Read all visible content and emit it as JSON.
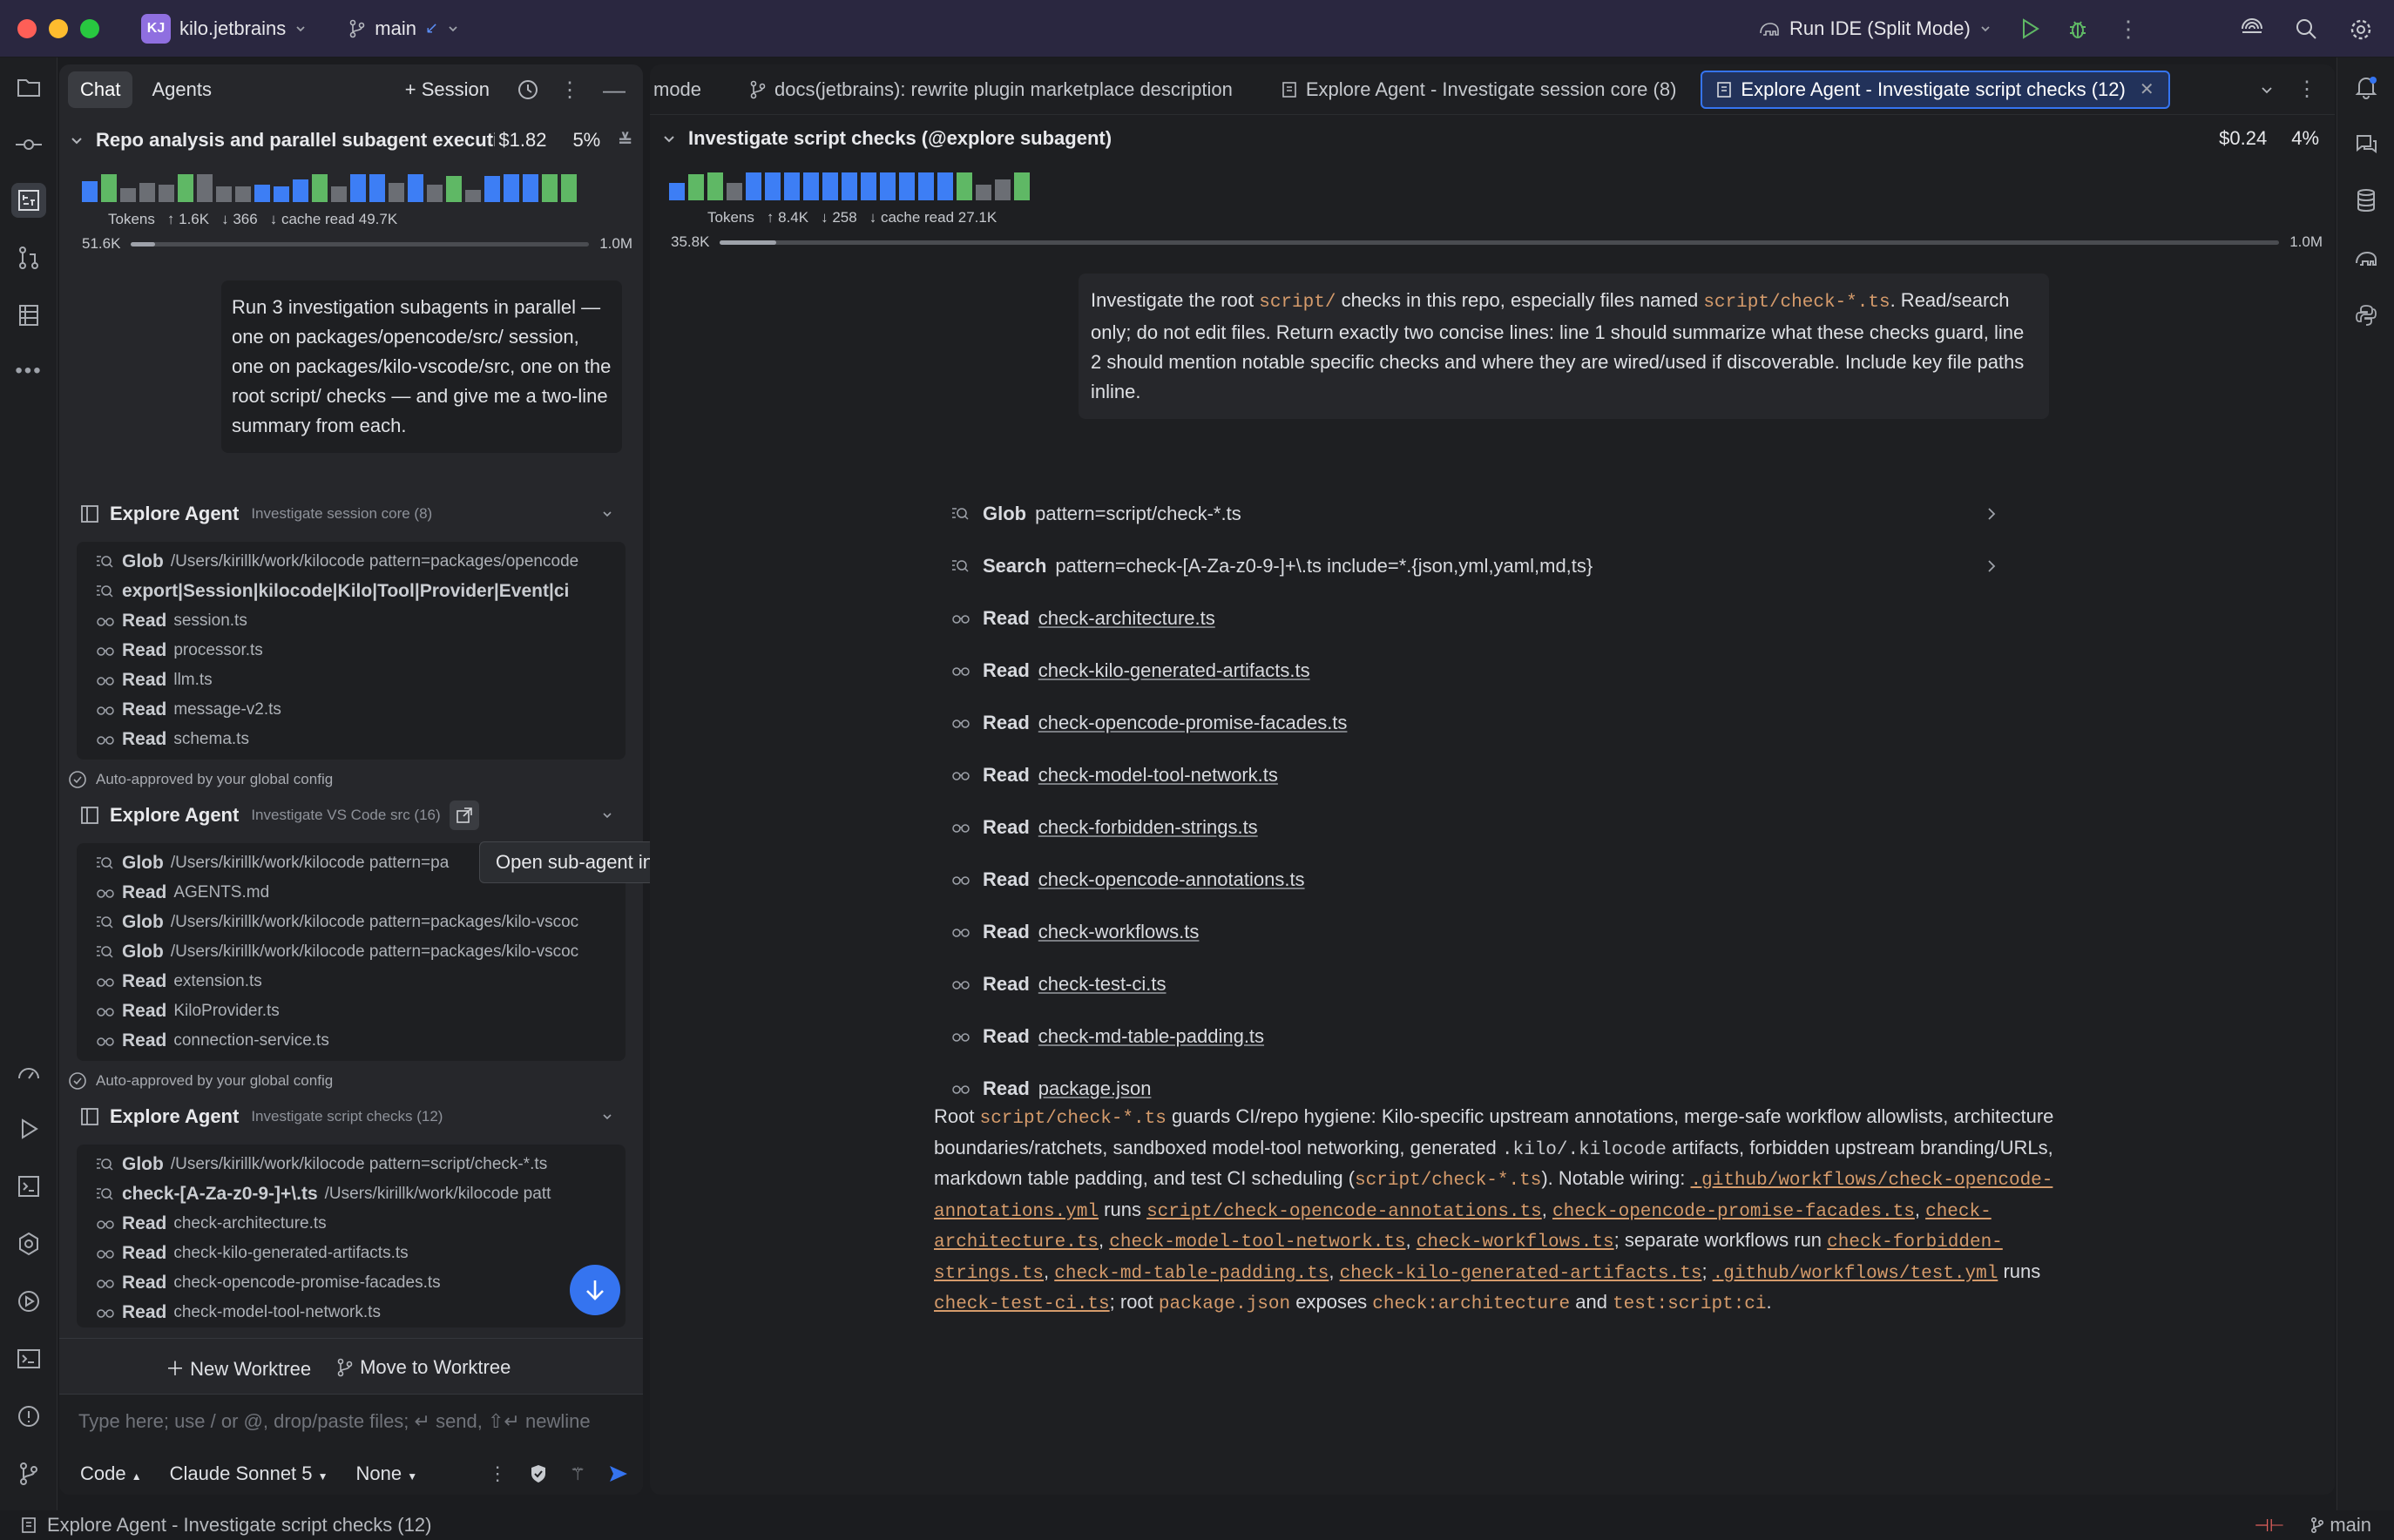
{
  "titlebar": {
    "project_badge": "KJ",
    "project_name": "kilo.jetbrains",
    "branch": "main",
    "run_config": "Run IDE (Split Mode)"
  },
  "chat": {
    "tabs": [
      "Chat",
      "Agents"
    ],
    "session_button": "+ Session",
    "session": {
      "title": "Repo analysis and parallel subagent executi...",
      "cost": "$1.82",
      "context_pct": "5%",
      "tokens_label": "Tokens",
      "tokens_up": "1.6K",
      "tokens_down": "366",
      "cache": "cache read 49.7K",
      "ctx_used": "51.6K",
      "ctx_max": "1.0M",
      "ctx_fraction": 0.052
    },
    "user_message": "Run 3 investigation subagents in parallel — one on packages/opencode/src/ session, one on packages/kilo-vscode/src, one on the root script/ checks — and give me a two-line summary from each.",
    "agents": [
      {
        "name": "Explore Agent",
        "desc": "Investigate session core (8)",
        "calls": [
          {
            "icon": "search-icon",
            "tool": "Glob",
            "arg": "/Users/kirillk/work/kilocode pattern=packages/opencode"
          },
          {
            "icon": "search-icon",
            "tool": "export|Session|kilocode|Kilo|Tool|Provider|Event|ci",
            "arg": ""
          },
          {
            "icon": "glasses-icon",
            "tool": "Read",
            "arg": "session.ts"
          },
          {
            "icon": "glasses-icon",
            "tool": "Read",
            "arg": "processor.ts"
          },
          {
            "icon": "glasses-icon",
            "tool": "Read",
            "arg": "llm.ts"
          },
          {
            "icon": "glasses-icon",
            "tool": "Read",
            "arg": "message-v2.ts"
          },
          {
            "icon": "glasses-icon",
            "tool": "Read",
            "arg": "schema.ts"
          }
        ],
        "approval": "Auto-approved by your global config"
      },
      {
        "name": "Explore Agent",
        "desc": "Investigate VS Code src (16)",
        "calls": [
          {
            "icon": "search-icon",
            "tool": "Glob",
            "arg": "/Users/kirillk/work/kilocode pattern=pa"
          },
          {
            "icon": "glasses-icon",
            "tool": "Read",
            "arg": "AGENTS.md"
          },
          {
            "icon": "search-icon",
            "tool": "Glob",
            "arg": "/Users/kirillk/work/kilocode pattern=packages/kilo-vscoc"
          },
          {
            "icon": "search-icon",
            "tool": "Glob",
            "arg": "/Users/kirillk/work/kilocode pattern=packages/kilo-vscoc"
          },
          {
            "icon": "glasses-icon",
            "tool": "Read",
            "arg": "extension.ts"
          },
          {
            "icon": "glasses-icon",
            "tool": "Read",
            "arg": "KiloProvider.ts"
          },
          {
            "icon": "glasses-icon",
            "tool": "Read",
            "arg": "connection-service.ts"
          }
        ],
        "approval": "Auto-approved by your global config"
      },
      {
        "name": "Explore Agent",
        "desc": "Investigate script checks (12)",
        "calls": [
          {
            "icon": "search-icon",
            "tool": "Glob",
            "arg": "/Users/kirillk/work/kilocode pattern=script/check-*.ts"
          },
          {
            "icon": "search-icon",
            "tool": "check-[A-Za-z0-9-]+\\.ts",
            "arg": "/Users/kirillk/work/kilocode patt"
          },
          {
            "icon": "glasses-icon",
            "tool": "Read",
            "arg": "check-architecture.ts"
          },
          {
            "icon": "glasses-icon",
            "tool": "Read",
            "arg": "check-kilo-generated-artifacts.ts"
          },
          {
            "icon": "glasses-icon",
            "tool": "Read",
            "arg": "check-opencode-promise-facades.ts"
          },
          {
            "icon": "glasses-icon",
            "tool": "Read",
            "arg": "check-model-tool-network.ts"
          }
        ]
      }
    ],
    "tooltip": "Open sub-agent in editor",
    "worktree": {
      "new": "New Worktree",
      "move": "Move to Worktree"
    },
    "input_placeholder": "Type here; use / or @, drop/paste files; ↵ send, ⇧↵ newline",
    "mode": "Code",
    "model": "Claude Sonnet 5",
    "variant": "None"
  },
  "editor": {
    "tabs": [
      {
        "label": "mode",
        "icon": ""
      },
      {
        "label": "docs(jetbrains): rewrite plugin marketplace description",
        "icon": "branch-icon"
      },
      {
        "label": "Explore Agent - Investigate session core (8)",
        "icon": "doc-icon"
      },
      {
        "label": "Explore Agent - Investigate script checks (12)",
        "icon": "doc-icon",
        "active": true
      }
    ],
    "header": {
      "title": "Investigate script checks (@explore subagent)",
      "cost": "$0.24",
      "context_pct": "4%",
      "tokens_label": "Tokens",
      "tokens_up": "8.4K",
      "tokens_down": "258",
      "cache": "cache read 27.1K",
      "ctx_used": "35.8K",
      "ctx_max": "1.0M",
      "ctx_fraction": 0.036
    },
    "prompt": {
      "p1": "Investigate the root ",
      "c1": "script/",
      "p2": " checks in this repo, especially files named ",
      "c2": "script/check-*.ts",
      "p3": ". Read/search only; do not edit files. Return exactly two concise lines: line 1 should summarize what these checks guard, line 2 should mention notable specific checks and where they are wired/used if discoverable. Include key file paths inline."
    },
    "calls": [
      {
        "icon": "search-icon",
        "tool": "Glob",
        "arg": "pattern=script/check-*.ts",
        "expandable": true
      },
      {
        "icon": "search-icon",
        "tool": "Search",
        "arg": "pattern=check-[A-Za-z0-9-]+\\.ts include=*.{json,yml,yaml,md,ts}",
        "expandable": true
      },
      {
        "icon": "glasses-icon",
        "tool": "Read",
        "arg": "check-architecture.ts",
        "link": true
      },
      {
        "icon": "glasses-icon",
        "tool": "Read",
        "arg": "check-kilo-generated-artifacts.ts",
        "link": true
      },
      {
        "icon": "glasses-icon",
        "tool": "Read",
        "arg": "check-opencode-promise-facades.ts",
        "link": true
      },
      {
        "icon": "glasses-icon",
        "tool": "Read",
        "arg": "check-model-tool-network.ts",
        "link": true
      },
      {
        "icon": "glasses-icon",
        "tool": "Read",
        "arg": "check-forbidden-strings.ts",
        "link": true
      },
      {
        "icon": "glasses-icon",
        "tool": "Read",
        "arg": "check-opencode-annotations.ts",
        "link": true
      },
      {
        "icon": "glasses-icon",
        "tool": "Read",
        "arg": "check-workflows.ts",
        "link": true
      },
      {
        "icon": "glasses-icon",
        "tool": "Read",
        "arg": "check-test-ci.ts",
        "link": true
      },
      {
        "icon": "glasses-icon",
        "tool": "Read",
        "arg": "check-md-table-padding.ts",
        "link": true
      },
      {
        "icon": "glasses-icon",
        "tool": "Read",
        "arg": "package.json",
        "link": true
      }
    ],
    "summary": {
      "s1": "Root ",
      "c1": "script/check-*.ts",
      "s2": " guards CI/repo hygiene: Kilo-specific upstream annotations, merge-safe workflow allowlists, architecture boundaries/ratchets, sandboxed model-tool networking, generated ",
      "c2": ".kilo/.kilocode",
      "s3": " artifacts, forbidden upstream branding/URLs, markdown table padding, and test CI scheduling (",
      "c3": "script/check-*.ts",
      "s4": "). Notable wiring: ",
      "u1": ".github/workflows/check-opencode-annotations.yml",
      "s5": " runs ",
      "u2": "script/check-opencode-annotations.ts",
      "s6": ", ",
      "u3": "check-opencode-promise-facades.ts",
      "s7": ", ",
      "u4": "check-architecture.ts",
      "s8": ", ",
      "u5": "check-model-tool-network.ts",
      "s9": ", ",
      "u6": "check-workflows.ts",
      "s10": "; separate workflows run ",
      "u7": "check-forbidden-strings.ts",
      "s11": ", ",
      "u8": "check-md-table-padding.ts",
      "s12": ", ",
      "u9": "check-kilo-generated-artifacts.ts",
      "s13": "; ",
      "u10": ".github/workflows/test.yml",
      "s14": " runs ",
      "u11": "check-test-ci.ts",
      "s15": "; root ",
      "c4": "package.json",
      "s16": " exposes ",
      "c5": "check:architecture",
      "s17": " and ",
      "c6": "test:script:ci",
      "s18": "."
    }
  },
  "statusbar": {
    "text": "Explore Agent - Investigate script checks (12)",
    "branch": "main"
  },
  "colors": {
    "accent": "#3574f0",
    "green_bar": "#5fb865",
    "blue_bar": "#3d7ef5",
    "gray_bar": "#6b6e74",
    "code": "#d59b6b",
    "titlebar": "#2a2740"
  }
}
